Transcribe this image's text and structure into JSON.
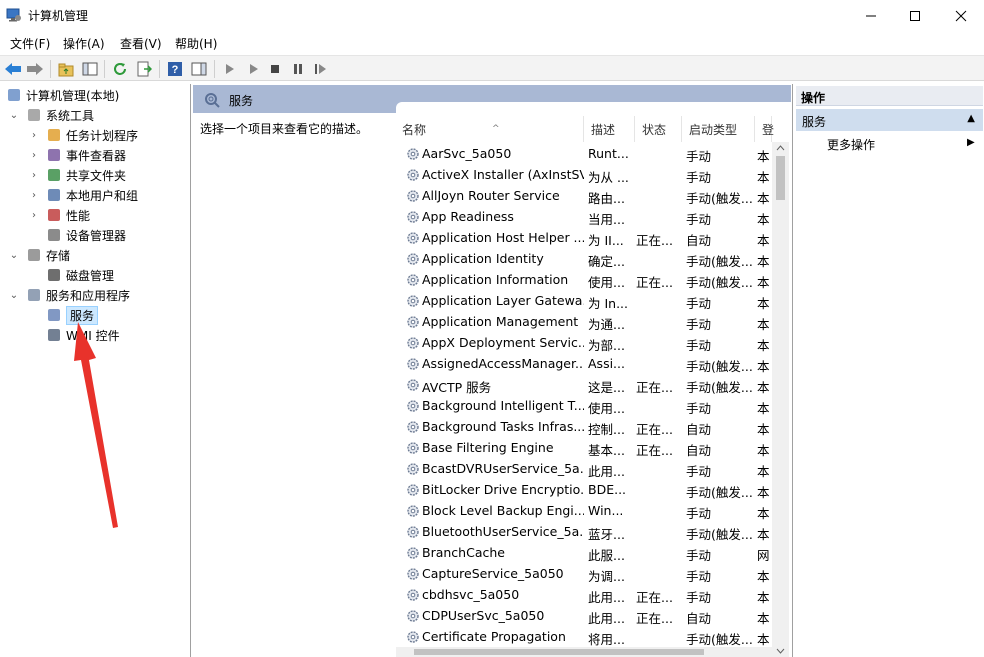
{
  "window": {
    "title": "计算机管理"
  },
  "menu": [
    "文件(F)",
    "操作(A)",
    "查看(V)",
    "帮助(H)"
  ],
  "tree": [
    {
      "label": "计算机管理(本地)",
      "indent": 0,
      "exp": "",
      "icon": "computer-management-icon"
    },
    {
      "label": "系统工具",
      "indent": 1,
      "exp": "v",
      "icon": "tools-icon"
    },
    {
      "label": "任务计划程序",
      "indent": 2,
      "exp": ">",
      "icon": "clock-icon"
    },
    {
      "label": "事件查看器",
      "indent": 2,
      "exp": ">",
      "icon": "event-viewer-icon"
    },
    {
      "label": "共享文件夹",
      "indent": 2,
      "exp": ">",
      "icon": "shared-folder-icon"
    },
    {
      "label": "本地用户和组",
      "indent": 2,
      "exp": ">",
      "icon": "users-icon"
    },
    {
      "label": "性能",
      "indent": 2,
      "exp": ">",
      "icon": "performance-icon"
    },
    {
      "label": "设备管理器",
      "indent": 2,
      "exp": "",
      "icon": "device-manager-icon"
    },
    {
      "label": "存储",
      "indent": 1,
      "exp": "v",
      "icon": "storage-icon"
    },
    {
      "label": "磁盘管理",
      "indent": 2,
      "exp": "",
      "icon": "disk-icon"
    },
    {
      "label": "服务和应用程序",
      "indent": 1,
      "exp": "v",
      "icon": "services-apps-icon"
    },
    {
      "label": "服务",
      "indent": 2,
      "exp": "",
      "icon": "gear-icon",
      "selected": true
    },
    {
      "label": "WMI 控件",
      "indent": 2,
      "exp": "",
      "icon": "wmi-icon"
    }
  ],
  "middle": {
    "header": "服务",
    "description": "选择一个项目来查看它的描述。",
    "columns": [
      "名称",
      "描述",
      "状态",
      "启动类型",
      "登"
    ],
    "rows": [
      [
        "AarSvc_5a050",
        "Runt...",
        "",
        "手动",
        "本"
      ],
      [
        "ActiveX Installer (AxInstSV)",
        "为从 ...",
        "",
        "手动",
        "本"
      ],
      [
        "AllJoyn Router Service",
        "路由...",
        "",
        "手动(触发...",
        "本"
      ],
      [
        "App Readiness",
        "当用...",
        "",
        "手动",
        "本"
      ],
      [
        "Application Host Helper ...",
        "为 II...",
        "正在...",
        "自动",
        "本"
      ],
      [
        "Application Identity",
        "确定...",
        "",
        "手动(触发...",
        "本"
      ],
      [
        "Application Information",
        "使用...",
        "正在...",
        "手动(触发...",
        "本"
      ],
      [
        "Application Layer Gatewa...",
        "为 In...",
        "",
        "手动",
        "本"
      ],
      [
        "Application Management",
        "为通...",
        "",
        "手动",
        "本"
      ],
      [
        "AppX Deployment Servic...",
        "为部...",
        "",
        "手动",
        "本"
      ],
      [
        "AssignedAccessManager...",
        "Assi...",
        "",
        "手动(触发...",
        "本"
      ],
      [
        "AVCTP 服务",
        "这是...",
        "正在...",
        "手动(触发...",
        "本"
      ],
      [
        "Background Intelligent T...",
        "使用...",
        "",
        "手动",
        "本"
      ],
      [
        "Background Tasks Infras...",
        "控制...",
        "正在...",
        "自动",
        "本"
      ],
      [
        "Base Filtering Engine",
        "基本...",
        "正在...",
        "自动",
        "本"
      ],
      [
        "BcastDVRUserService_5a...",
        "此用...",
        "",
        "手动",
        "本"
      ],
      [
        "BitLocker Drive Encryptio...",
        "BDE...",
        "",
        "手动(触发...",
        "本"
      ],
      [
        "Block Level Backup Engi...",
        "Win...",
        "",
        "手动",
        "本"
      ],
      [
        "BluetoothUserService_5a...",
        "蓝牙...",
        "",
        "手动(触发...",
        "本"
      ],
      [
        "BranchCache",
        "此服...",
        "",
        "手动",
        "网"
      ],
      [
        "CaptureService_5a050",
        "为调...",
        "",
        "手动",
        "本"
      ],
      [
        "cbdhsvc_5a050",
        "此用...",
        "正在...",
        "手动",
        "本"
      ],
      [
        "CDPUserSvc_5a050",
        "此用...",
        "正在...",
        "自动",
        "本"
      ],
      [
        "Certificate Propagation",
        "将用...",
        "",
        "手动(触发...",
        "本"
      ]
    ]
  },
  "actions": {
    "title": "操作",
    "section": "服务",
    "item": "更多操作"
  },
  "colors": {
    "header_bg": "#a9b8d4",
    "selection": "#cce8ff",
    "annotation": "#e8322b"
  }
}
